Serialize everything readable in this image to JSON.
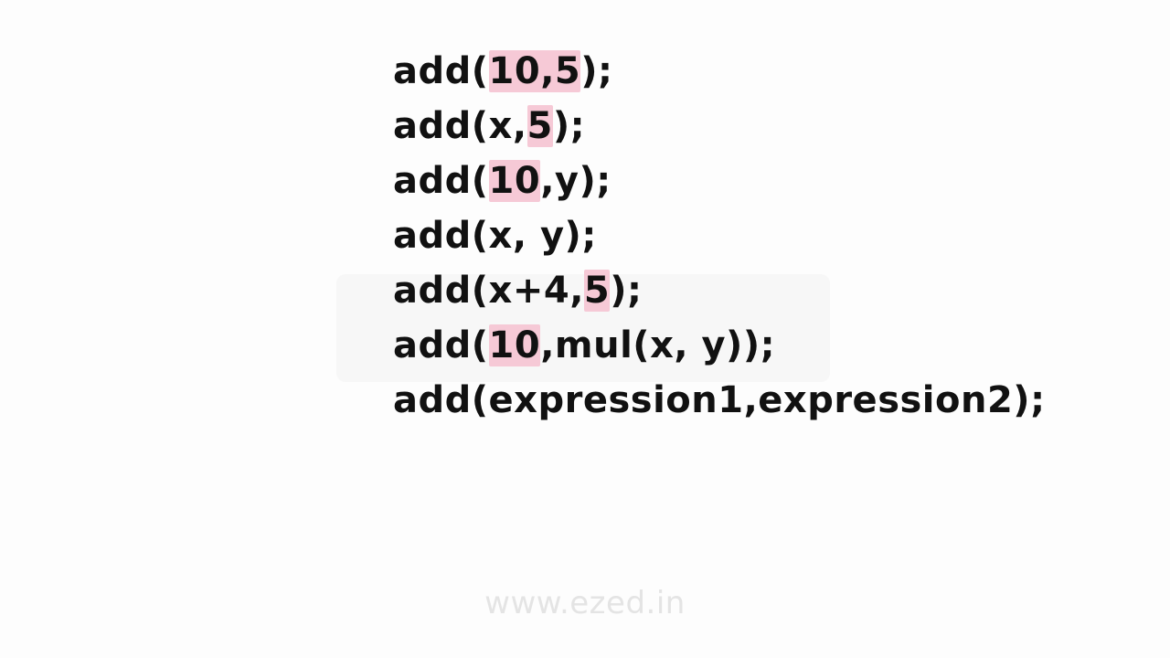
{
  "colors": {
    "background": "#fdfdfd",
    "text": "#111111",
    "highlight": "#f6c9d6",
    "watermark_text": "#e4e4e4"
  },
  "code_lines": [
    [
      {
        "text": "add(",
        "highlight": false
      },
      {
        "text": "10,5",
        "highlight": true
      },
      {
        "text": ");",
        "highlight": false
      }
    ],
    [
      {
        "text": "add(x,",
        "highlight": false
      },
      {
        "text": "5",
        "highlight": true
      },
      {
        "text": ");",
        "highlight": false
      }
    ],
    [
      {
        "text": "add(",
        "highlight": false
      },
      {
        "text": "10",
        "highlight": true
      },
      {
        "text": ",y);",
        "highlight": false
      }
    ],
    [
      {
        "text": "add(x, y);",
        "highlight": false
      }
    ],
    [
      {
        "text": "add(x+4,",
        "highlight": false
      },
      {
        "text": "5",
        "highlight": true
      },
      {
        "text": ");",
        "highlight": false
      }
    ],
    [
      {
        "text": "add(",
        "highlight": false
      },
      {
        "text": "10",
        "highlight": true
      },
      {
        "text": ",mul(x, y));",
        "highlight": false
      }
    ],
    [
      {
        "text": "add(expression1,expression2);",
        "highlight": false
      }
    ]
  ],
  "footer": {
    "url": "www.ezed.in"
  }
}
